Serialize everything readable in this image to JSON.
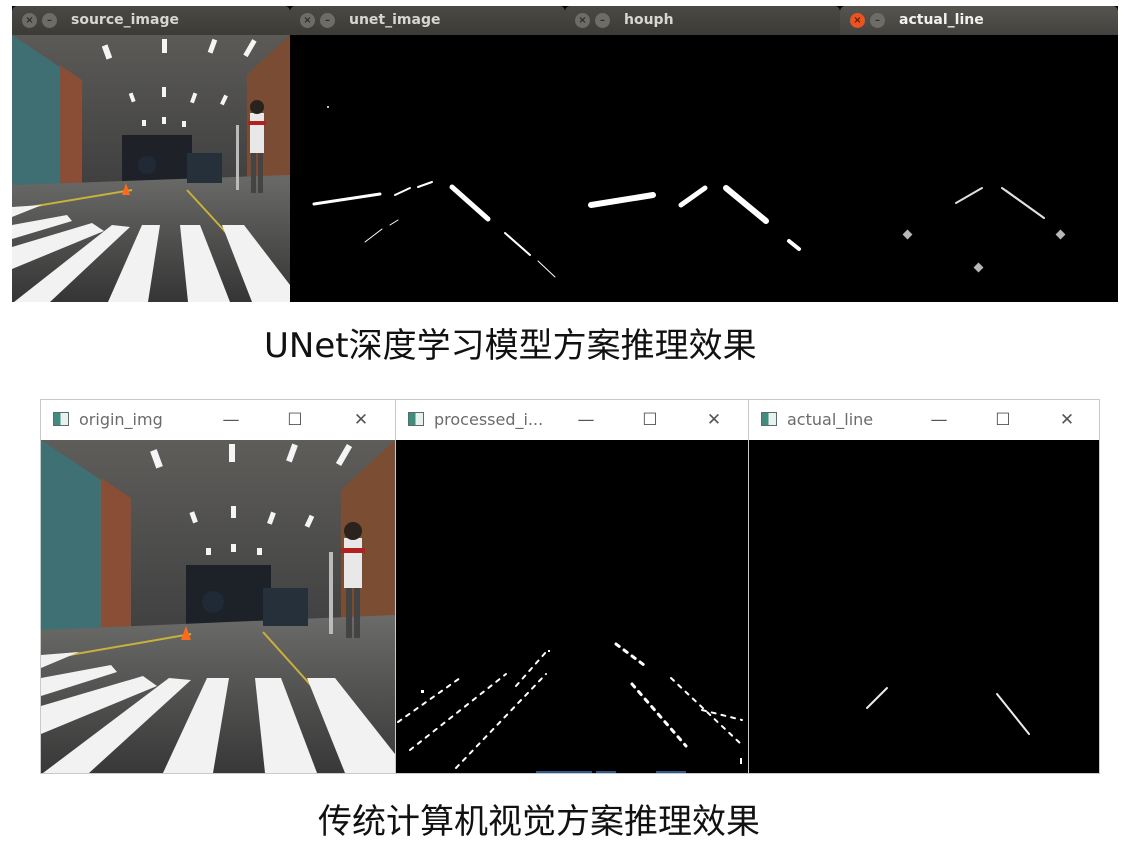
{
  "top_row": {
    "windows": [
      {
        "title": "source_image",
        "active": false
      },
      {
        "title": "unet_image",
        "active": false
      },
      {
        "title": "houph",
        "active": false
      },
      {
        "title": "actual_line",
        "active": true
      }
    ],
    "close_icon": "close-icon",
    "minimize_icon": "minimize-icon",
    "caption": "UNet深度学习模型方案推理效果"
  },
  "bottom_row": {
    "windows": [
      {
        "title": "origin_img"
      },
      {
        "title": "processed_i..."
      },
      {
        "title": "actual_line"
      }
    ],
    "controls": {
      "minimize": "—",
      "maximize": "☐",
      "close": "✕"
    },
    "caption": "传统计算机视觉方案推理效果"
  },
  "colors": {
    "ubuntu_titlebar": "#3c3b37",
    "ubuntu_close_active": "#e95420",
    "image_background": "#000000",
    "lane_marking": "#ffffff"
  }
}
